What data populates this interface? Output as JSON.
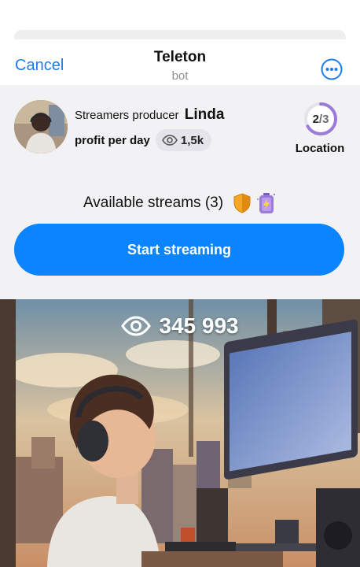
{
  "header": {
    "cancel_label": "Cancel",
    "title": "Teleton",
    "subtitle": "bot",
    "more_icon": "more-horizontal-circle-icon"
  },
  "profile": {
    "role_label": "Streamers producer",
    "name": "Linda",
    "profit_label": "profit per day",
    "profit_value": "1,5k",
    "profit_icon": "eye-icon"
  },
  "location": {
    "current": "2",
    "total": "/3",
    "progress_fraction": 0.667,
    "label": "Location"
  },
  "streams": {
    "label": "Available streams (3)",
    "icons": [
      "shield-icon",
      "energy-battery-icon"
    ]
  },
  "cta": {
    "start_label": "Start streaming"
  },
  "scene": {
    "views_count": "345 993",
    "views_icon": "eye-icon"
  },
  "colors": {
    "accent": "#0a84ff",
    "link": "#1a7cf0",
    "panel_bg": "#f2f2f4",
    "progress_ring": "#9b7bd8"
  }
}
